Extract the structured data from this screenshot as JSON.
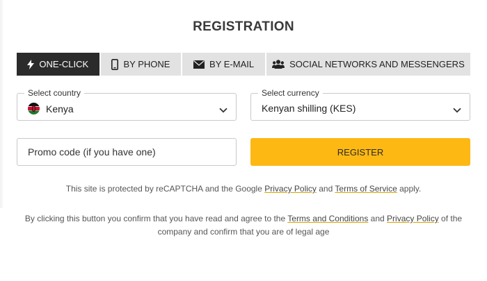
{
  "title": "REGISTRATION",
  "tabs": [
    {
      "label": "ONE-CLICK",
      "icon": "lightning-icon",
      "active": true
    },
    {
      "label": "BY PHONE",
      "icon": "phone-icon",
      "active": false
    },
    {
      "label": "BY E-MAIL",
      "icon": "envelope-icon",
      "active": false
    },
    {
      "label": "SOCIAL NETWORKS AND MESSENGERS",
      "icon": "users-icon",
      "active": false
    }
  ],
  "country": {
    "label": "Select country",
    "value": "Kenya",
    "flag_icon": "kenya-flag-icon"
  },
  "currency": {
    "label": "Select currency",
    "value": "Kenyan shilling (KES)"
  },
  "promo": {
    "placeholder": "Promo code (if you have one)"
  },
  "register_label": "REGISTER",
  "recaptcha": {
    "prefix": "This site is protected by reCAPTCHA and the Google ",
    "privacy_link": "Privacy Policy",
    "and": " and ",
    "terms_link": "Terms of Service",
    "suffix": " apply."
  },
  "terms": {
    "prefix": "By clicking this button you confirm that you have read and agree to the ",
    "terms_link": "Terms and Conditions",
    "and": " and ",
    "privacy_link": "Privacy Policy",
    "suffix": " of the company and confirm that you are of legal age"
  },
  "colors": {
    "accent": "#fdb814",
    "active_tab": "#2b2b2b",
    "tab": "#e2e2e2"
  }
}
